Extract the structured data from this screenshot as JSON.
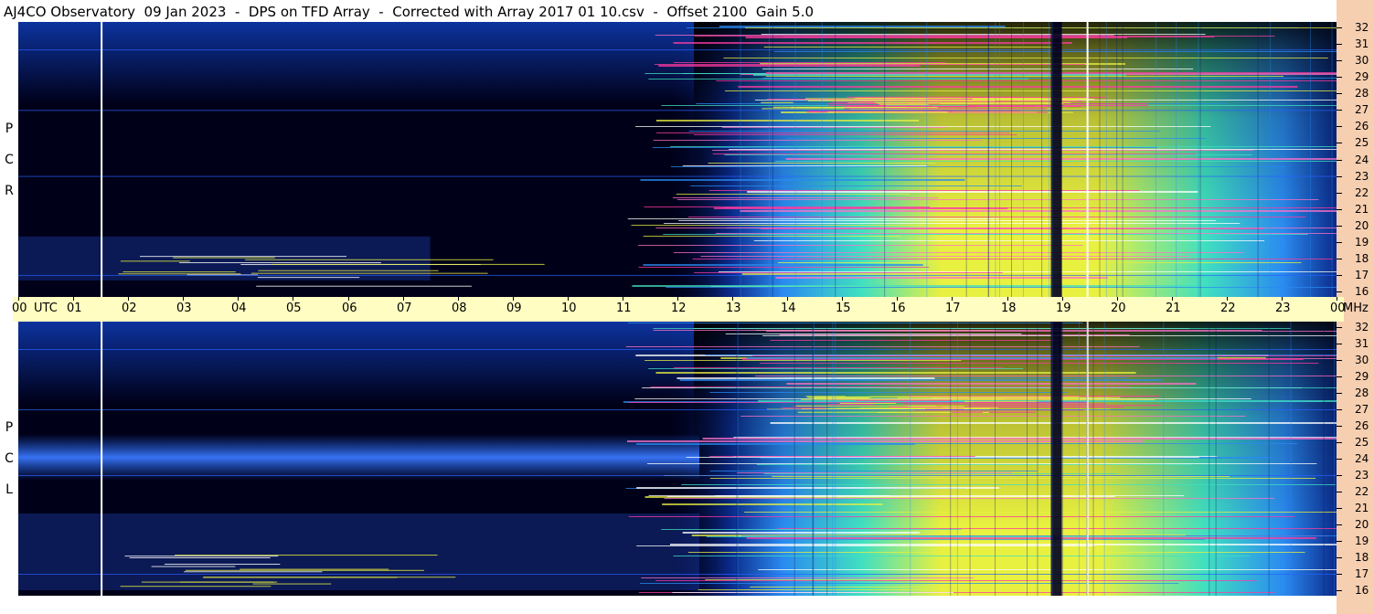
{
  "title": "AJ4CO Observatory  09 Jan 2023  -  DPS on TFD Array  -  Corrected with Array 2017 01 10.csv  -  Offset 2100  Gain 5.0",
  "panels": {
    "top": {
      "name": "RCP",
      "letters": [
        "P",
        "C",
        "R"
      ]
    },
    "bottom": {
      "name": "LCP",
      "letters": [
        "P",
        "C",
        "L"
      ]
    }
  },
  "utc_axis": {
    "unit_label": "UTC",
    "hour_labels": [
      "00",
      "01",
      "02",
      "03",
      "04",
      "05",
      "06",
      "07",
      "08",
      "09",
      "10",
      "11",
      "12",
      "13",
      "14",
      "15",
      "16",
      "17",
      "18",
      "19",
      "20",
      "21",
      "22",
      "23",
      "00"
    ],
    "end_unit": "MHz"
  },
  "freq_axis": {
    "labels": [
      "32",
      "31",
      "30",
      "29",
      "28",
      "27",
      "26",
      "25",
      "24",
      "23",
      "22",
      "21",
      "20",
      "19",
      "18",
      "17",
      "16"
    ]
  },
  "colors": {
    "background": "#000018",
    "low": "#0a2a8a",
    "mid": "#2a8af0",
    "high": "#40e0c0",
    "peak": "#e8f040",
    "hot": "#ff3aa0",
    "utc_bar": "#fffdc2",
    "freq_bar": "#f6ceb0"
  },
  "chart_data": {
    "type": "heatmap",
    "title": "AJ4CO Observatory  09 Jan 2023  -  DPS on TFD Array  -  Corrected with Array 2017 01 10.csv  -  Offset 2100  Gain 5.0",
    "x_axis": {
      "label": "UTC",
      "range": [
        0,
        24
      ],
      "ticks": [
        "00",
        "01",
        "02",
        "03",
        "04",
        "05",
        "06",
        "07",
        "08",
        "09",
        "10",
        "11",
        "12",
        "13",
        "14",
        "15",
        "16",
        "17",
        "18",
        "19",
        "20",
        "21",
        "22",
        "23",
        "00"
      ]
    },
    "y_axis": {
      "label": "MHz",
      "range": [
        16,
        32
      ],
      "ticks": [
        32,
        31,
        30,
        29,
        28,
        27,
        26,
        25,
        24,
        23,
        22,
        21,
        20,
        19,
        18,
        17,
        16
      ]
    },
    "panels": [
      "RCP",
      "LCP"
    ],
    "white_vertical_markers_utc": [
      1.5,
      19.45
    ],
    "dark_vertical_band_utc": [
      18.8,
      19.0
    ],
    "daytime_noise_utc": [
      12.5,
      23.8
    ]
  }
}
